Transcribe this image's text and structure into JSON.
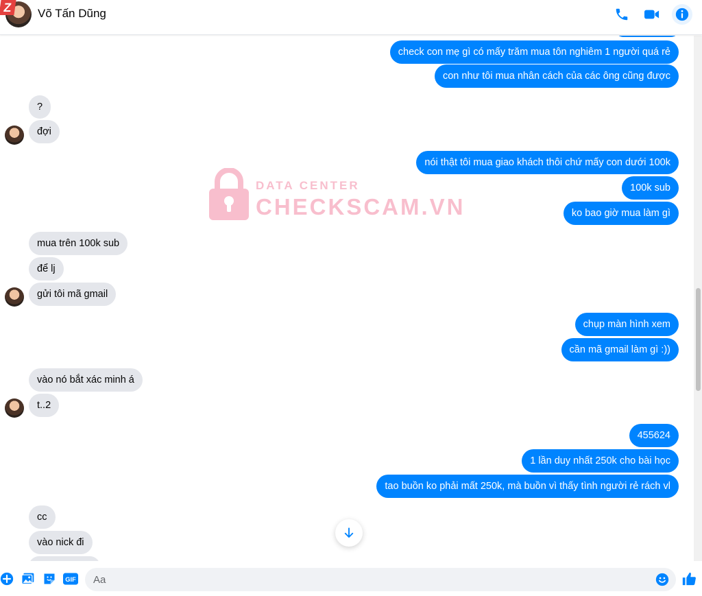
{
  "header": {
    "contact_name": "Võ Tấn Dũng",
    "logo_letter": "Z",
    "icons": [
      "phone-icon",
      "video-icon",
      "info-icon"
    ]
  },
  "brand_color": "#0084ff",
  "watermark": {
    "line1": "DATA CENTER",
    "line2": "CHECKSCAM.VN"
  },
  "messages": [
    {
      "side": "out",
      "text": "check con mẹ gì có mấy trăm mua tôn nghiêm 1 người quá rẻ"
    },
    {
      "side": "out",
      "text": "con như tôi mua nhân cách của các ông cũng được"
    },
    {
      "side": "in",
      "text": "?"
    },
    {
      "side": "in",
      "text": "đợi"
    },
    {
      "side": "out",
      "text": "nói thật tôi mua giao khách thôi chứ mấy con dưới 100k"
    },
    {
      "side": "out",
      "text": "100k sub"
    },
    {
      "side": "out",
      "text": "ko bao giờ mua làm gì"
    },
    {
      "side": "in",
      "text": "mua trên 100k sub"
    },
    {
      "side": "in",
      "text": "để lj"
    },
    {
      "side": "in",
      "text": "gửi tôi mã gmail"
    },
    {
      "side": "out",
      "text": "chụp màn hình xem"
    },
    {
      "side": "out",
      "text": "cần mã gmail làm gì :))"
    },
    {
      "side": "in",
      "text": "vào nó bắt xác minh á"
    },
    {
      "side": "in",
      "text": "t..2"
    },
    {
      "side": "out",
      "text": "455624"
    },
    {
      "side": "out",
      "text": "1 lần duy nhất 250k cho bài học"
    },
    {
      "side": "out",
      "text": "tao buồn ko phải mất 250k, mà buồn vì thấy tình người rẻ rách vl"
    },
    {
      "side": "in",
      "text": "cc"
    },
    {
      "side": "in",
      "text": "vào nick đi"
    }
  ],
  "composer": {
    "placeholder": "Aa",
    "icons": [
      "plus-icon",
      "image-icon",
      "sticker-icon",
      "gif-icon",
      "emoji-icon",
      "like-icon"
    ],
    "gif_label": "GIF"
  }
}
